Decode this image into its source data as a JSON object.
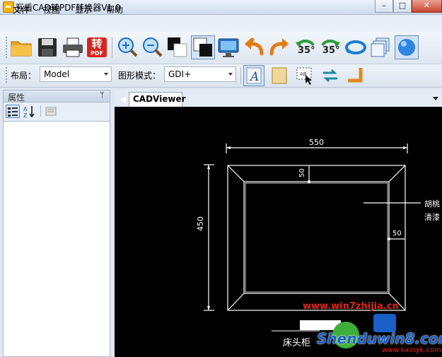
{
  "window": {
    "title": "互盾CAD转PDF转换器V1.0",
    "min": "–",
    "max": "□",
    "close": "✕"
  },
  "menu": [
    "文件",
    "视图",
    "显示",
    "帮助"
  ],
  "toolbar": {
    "rotate_left_label": "35°",
    "rotate_right_label": "35°",
    "convert_label_top": "转",
    "convert_label_bottom": "PDF"
  },
  "layout_bar": {
    "layout_label": "布局：",
    "layout_value": "Model",
    "mode_label": "图形模式：",
    "mode_value": "GDI+"
  },
  "properties_panel": {
    "title": "属性",
    "pin": "ᛘ"
  },
  "document": {
    "tab": "CADViewer"
  },
  "drawing": {
    "dim_width": "550",
    "dim_height": "450",
    "dim_top_frame": "50",
    "dim_right_frame": "50",
    "note_line1": "胡桃",
    "note_line2": "清漆",
    "caption": "床头柜"
  },
  "watermarks": {
    "site1": "www.win7zhijia.cn",
    "site2": "Shenduwin8.com",
    "site3": "www.kxinyk.com"
  },
  "colors": {
    "canvas": "#000000",
    "drawing_lines": "#ffffff",
    "watermark_red": "#e0241b",
    "watermark_blue": "#1a5fc8"
  }
}
